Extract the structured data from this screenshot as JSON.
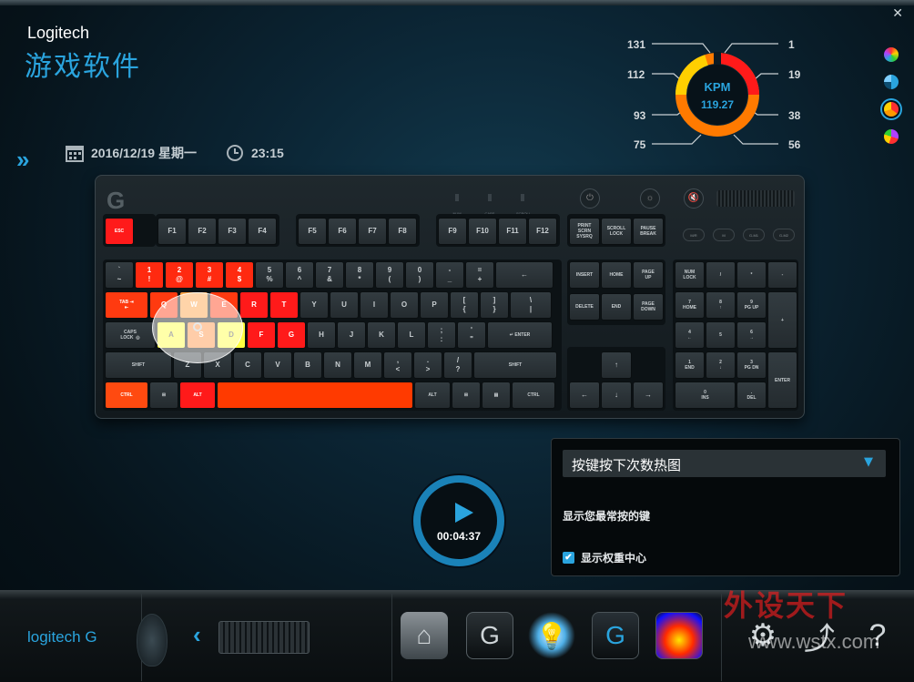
{
  "window": {
    "close": "✕"
  },
  "brand": {
    "en": "Logitech",
    "cn": "游戏软件"
  },
  "status": {
    "date": "2016/12/19 星期一",
    "time": "23:15"
  },
  "kpm": {
    "title": "KPM",
    "value": "119.27",
    "scale_left": [
      "131",
      "112",
      "93",
      "75"
    ],
    "scale_right": [
      "1",
      "19",
      "38",
      "56"
    ]
  },
  "color_modes": [
    "#ff3030",
    "#2aa4de",
    "#ff9900",
    "#b040ff"
  ],
  "keyboard": {
    "logo": "G",
    "leds": [
      "NUM LOCK",
      "CAPS LOCK",
      "SCROLL LOCK"
    ],
    "media_keys": [
      "⏻",
      "☼",
      "🔇"
    ],
    "macro_keys": [
      "M/R",
      "M",
      "G-M1",
      "G-M2"
    ],
    "rows": {
      "fkeys": [
        {
          "label": "ESC",
          "heat": "#ff1a1a"
        },
        {
          "label": "F1"
        },
        {
          "label": "F2"
        },
        {
          "label": "F3"
        },
        {
          "label": "F4"
        },
        {
          "label": "F5"
        },
        {
          "label": "F6"
        },
        {
          "label": "F7"
        },
        {
          "label": "F8"
        },
        {
          "label": "F9"
        },
        {
          "label": "F10"
        },
        {
          "label": "F11"
        },
        {
          "label": "F12"
        }
      ],
      "sys": [
        "PRINT\nSCRN\nSYSRQ",
        "SCROLL\nLOCK",
        "PAUSE\nBREAK"
      ],
      "num": [
        {
          "label": "`\n~"
        },
        {
          "label": "1\n!",
          "heat": "#ff2a10"
        },
        {
          "label": "2\n@",
          "heat": "#ff2a10"
        },
        {
          "label": "3\n#",
          "heat": "#ff2a10"
        },
        {
          "label": "4\n$",
          "heat": "#ff2a10"
        },
        {
          "label": "5\n%"
        },
        {
          "label": "6\n^"
        },
        {
          "label": "7\n&"
        },
        {
          "label": "8\n*"
        },
        {
          "label": "9\n("
        },
        {
          "label": "0\n)"
        },
        {
          "label": "-\n_"
        },
        {
          "label": "=\n+"
        },
        {
          "label": "←"
        }
      ],
      "qwerty": [
        {
          "label": "TAB ⇥\n⇤",
          "heat": "#ff3a10"
        },
        {
          "label": "Q",
          "heat": "#ff3a10"
        },
        {
          "label": "W",
          "heat": "#ffa040"
        },
        {
          "label": "E",
          "heat": "#ff3a10"
        },
        {
          "label": "R",
          "heat": "#ff1a1a"
        },
        {
          "label": "T",
          "heat": "#ff1a1a"
        },
        {
          "label": "Y"
        },
        {
          "label": "U"
        },
        {
          "label": "I"
        },
        {
          "label": "O"
        },
        {
          "label": "P"
        },
        {
          "label": "[\n{"
        },
        {
          "label": "]\n}"
        },
        {
          "label": "\\\n|"
        }
      ],
      "home": [
        {
          "label": "CAPS\nLOCK  ◎"
        },
        {
          "label": "A",
          "heat": "#ffff40"
        },
        {
          "label": "S",
          "heat": "#ff9040"
        },
        {
          "label": "D",
          "heat": "#ffff40"
        },
        {
          "label": "F",
          "heat": "#ff1a1a"
        },
        {
          "label": "G",
          "heat": "#ff1a1a"
        },
        {
          "label": "H"
        },
        {
          "label": "J"
        },
        {
          "label": "K"
        },
        {
          "label": "L"
        },
        {
          "label": ";\n:"
        },
        {
          "label": "'\n\""
        },
        {
          "label": "↵ ENTER"
        }
      ],
      "shift": [
        {
          "label": "SHIFT"
        },
        {
          "label": "Z"
        },
        {
          "label": "X"
        },
        {
          "label": "C"
        },
        {
          "label": "V"
        },
        {
          "label": "B"
        },
        {
          "label": "N"
        },
        {
          "label": "M"
        },
        {
          "label": ",\n<"
        },
        {
          "label": ".\n>"
        },
        {
          "label": "/\n?"
        },
        {
          "label": "SHIFT"
        }
      ],
      "bottom": [
        {
          "label": "CTRL",
          "heat": "#ff4a10"
        },
        {
          "label": "⊞"
        },
        {
          "label": "ALT",
          "heat": "#ff1a1a"
        },
        {
          "label": "",
          "heat": "#ff3a00"
        },
        {
          "label": "ALT"
        },
        {
          "label": "⊞"
        },
        {
          "label": "▤"
        },
        {
          "label": "CTRL"
        }
      ],
      "nav": [
        "INSERT",
        "HOME",
        "PAGE\nUP",
        "DELETE",
        "END",
        "PAGE\nDOWN"
      ],
      "arrows": [
        "↑",
        "←",
        "↓",
        "→"
      ],
      "numpad": [
        "NUM\nLOCK",
        "/",
        "*",
        "-",
        "7\nHOME",
        "8\n↑",
        "9\nPG UP",
        "+",
        "4\n←",
        "5",
        "6\n→",
        "1\nEND",
        "2\n↓",
        "3\nPG DN",
        "ENTER",
        "0\nINS",
        ".\nDEL"
      ]
    }
  },
  "playback": {
    "time": "00:04:37"
  },
  "panel": {
    "dropdown": "按键按下次数热图",
    "description": "显示您最常按的键",
    "checkbox_label": "显示权重中心"
  },
  "bottombar": {
    "logo": "logitech G",
    "back": "‹",
    "gear": "⚙",
    "share": "⤴",
    "help": "?"
  },
  "watermark": {
    "text": "外设天下",
    "site": "www.wstx.com"
  }
}
